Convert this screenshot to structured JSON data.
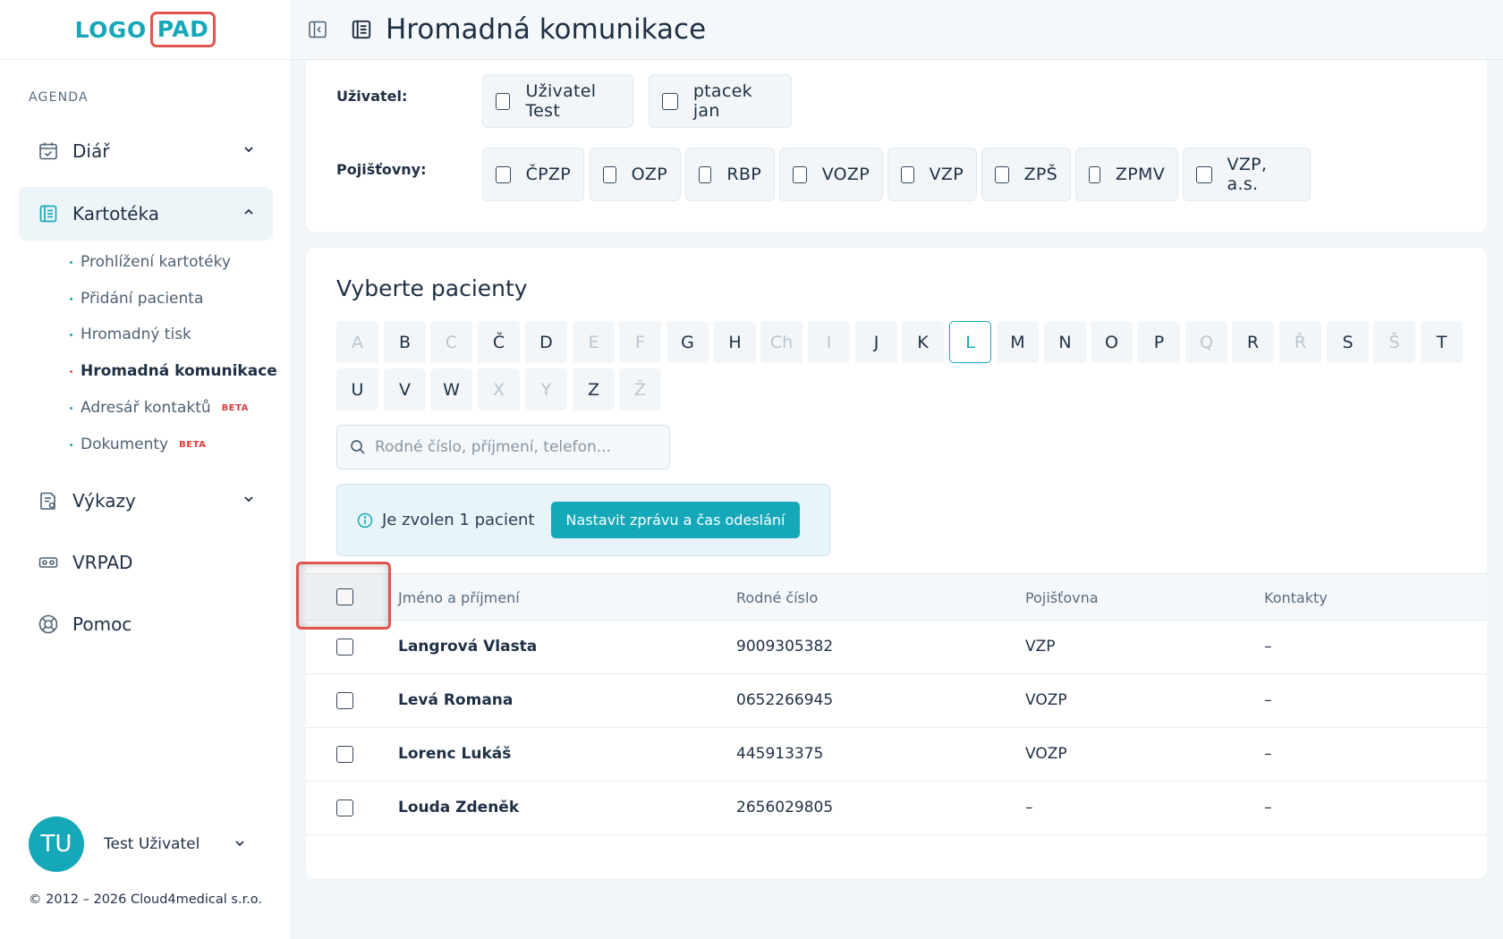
{
  "logo": {
    "part1": "LOGO",
    "part2": "PAD"
  },
  "sidebar": {
    "section_label": "AGENDA",
    "items": [
      {
        "label": "Diář"
      },
      {
        "label": "Kartotéka"
      },
      {
        "label": "Výkazy"
      },
      {
        "label": "VRPAD"
      },
      {
        "label": "Pomoc"
      }
    ],
    "sub_items": [
      {
        "label": "Prohlížení kartotéky"
      },
      {
        "label": "Přidání pacienta"
      },
      {
        "label": "Hromadný tisk"
      },
      {
        "label": "Hromadná komunikace"
      },
      {
        "label": "Adresář kontaktů",
        "badge": "BETA"
      },
      {
        "label": "Dokumenty",
        "badge": "BETA"
      }
    ],
    "user": {
      "initials": "TU",
      "name": "Test Uživatel"
    },
    "copyright": "© 2012 – 2026 Cloud4medical s.r.o."
  },
  "header": {
    "title": "Hromadná komunikace"
  },
  "filters": {
    "user_label": "Uživatel:",
    "users": [
      "Uživatel Test",
      "ptacek jan"
    ],
    "insurance_label": "Pojišťovny:",
    "insurances": [
      "ČPZP",
      "OZP",
      "RBP",
      "VOZP",
      "VZP",
      "ZPŠ",
      "ZPMV",
      "VZP, a.s."
    ]
  },
  "patients": {
    "title": "Vyberte pacienty",
    "letters_row1": [
      "A",
      "B",
      "C",
      "Č",
      "D",
      "E",
      "F",
      "G",
      "H",
      "Ch",
      "I",
      "J",
      "K",
      "L",
      "M",
      "N",
      "O",
      "P",
      "Q",
      "R",
      "Ř",
      "S",
      "Š",
      "T"
    ],
    "letters_row2": [
      "U",
      "V",
      "W",
      "X",
      "Y",
      "Z",
      "Ž"
    ],
    "selected_letter": "L",
    "search_placeholder": "Rodné číslo, příjmení, telefon...",
    "info_text": "Je zvolen 1 pacient",
    "info_button": "Nastavit zprávu a čas odeslání",
    "columns": [
      "Jméno a příjmení",
      "Rodné číslo",
      "Pojišťovna",
      "Kontakty"
    ],
    "rows": [
      {
        "name": "Langrová Vlasta",
        "rc": "9009305382",
        "insurance": "VZP",
        "contacts": "–"
      },
      {
        "name": "Levá Romana",
        "rc": "0652266945",
        "insurance": "VOZP",
        "contacts": "–"
      },
      {
        "name": "Lorenc Lukáš",
        "rc": "445913375",
        "insurance": "VOZP",
        "contacts": "–"
      },
      {
        "name": "Louda Zdeněk",
        "rc": "2656029805",
        "insurance": "–",
        "contacts": "–"
      }
    ]
  },
  "colors": {
    "accent": "#15a8b8",
    "highlight": "#e0554f"
  }
}
